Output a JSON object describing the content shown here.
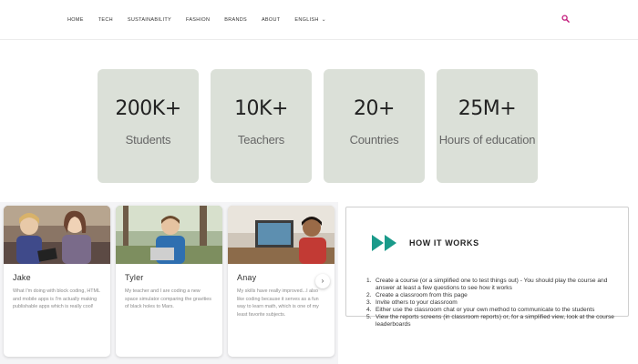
{
  "nav": {
    "items": [
      "HOME",
      "TECH",
      "SUSTAINABILITY",
      "FASHION",
      "BRANDS",
      "ABOUT"
    ],
    "language": "ENGLISH",
    "search_icon": "search-icon",
    "accent_color": "#c2187a"
  },
  "stats": [
    {
      "value": "200K+",
      "label": "Students"
    },
    {
      "value": "10K+",
      "label": "Teachers"
    },
    {
      "value": "20+",
      "label": "Countries"
    },
    {
      "value": "25M+",
      "label": "Hours of education"
    }
  ],
  "stat_bg_color": "#dbe0d8",
  "testimonials": [
    {
      "name": "Jake",
      "text": "What I'm doing with block coding, HTML and mobile apps is I'm actually making publishable apps which is really cool!"
    },
    {
      "name": "Tyler",
      "text": "My teacher and I are coding a new space simulator comparing the gravities of black holes to Mars."
    },
    {
      "name": "Anay",
      "text": "My skills have really improved...I also like coding because it serves as a fun way to learn math, which is one of my least favorite subjects."
    }
  ],
  "carousel_next_icon": "chevron-right-icon",
  "how_it_works": {
    "icon": "fast-forward-icon",
    "icon_color": "#1a9a8a",
    "title": "HOW IT WORKS",
    "steps": [
      "Create a course (or a simplified one to test things out) - You should play the course and answer at least a few questions to see how it works",
      "Create a classroom from this page",
      "Invite others to your classroom",
      "Either use the classroom chat or your own method to communicate to the students",
      "View the reports screens (in classroom reports) or, for a simplified view, look at the course leaderboards"
    ]
  }
}
